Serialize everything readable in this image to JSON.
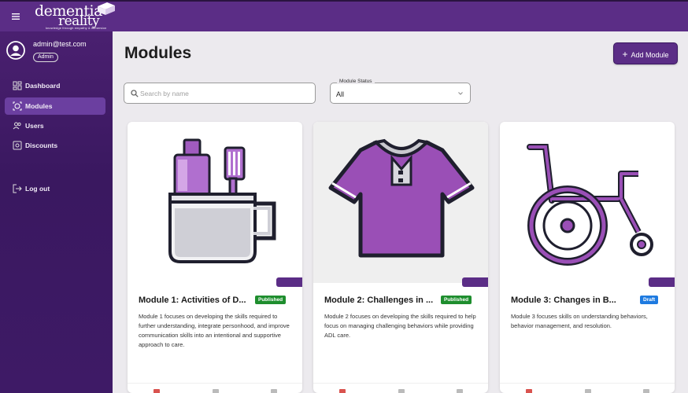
{
  "header": {
    "logo_line1": "dementia",
    "logo_line2": "reality",
    "logo_tagline": "knowledge through empathy & immersion",
    "menu_icon": "hamburger-icon"
  },
  "sidebar": {
    "user_email": "admin@test.com",
    "role": "Admin",
    "items": [
      {
        "label": "Dashboard",
        "icon": "dashboard-icon"
      },
      {
        "label": "Modules",
        "icon": "modules-icon"
      },
      {
        "label": "Users",
        "icon": "users-icon"
      },
      {
        "label": "Discounts",
        "icon": "discounts-icon"
      },
      {
        "label": "Log out",
        "icon": "logout-icon"
      }
    ]
  },
  "main": {
    "title": "Modules",
    "add_label": "Add Module",
    "search_placeholder": "Search by name",
    "status_label": "Module Status",
    "status_value": "All"
  },
  "cards": [
    {
      "title": "Module 1: Activities of D...",
      "status": "Published",
      "description": "Module 1 focuses on developing the skills required to further understanding, integrate personhood, and improve communication skills into an intentional and supportive approach to care.",
      "image": "toothbrush-cup-icon"
    },
    {
      "title": "Module 2: Challenges in ...",
      "status": "Published",
      "description": "Module 2 focuses on developing the skills required to help focus on managing challenging behaviors while providing ADL care.",
      "image": "shirt-icon"
    },
    {
      "title": "Module 3: Changes in B...",
      "status": "Draft",
      "description": "Module 3 focuses skills on understanding behaviors, behavior management, and resolution.",
      "image": "wheelchair-icon"
    }
  ],
  "colors": {
    "brand": "#5b2d86",
    "published": "#1e8e2e",
    "draft": "#1e7ae0"
  }
}
